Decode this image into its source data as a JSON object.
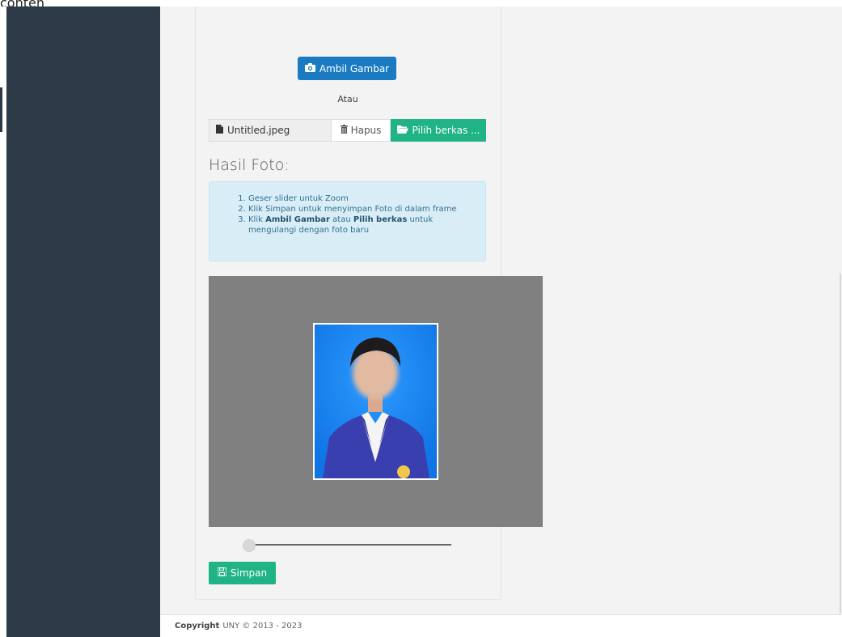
{
  "top_partial_text": "conten",
  "buttons": {
    "ambil": {
      "label": "Ambil Gambar",
      "icon": "camera-icon"
    },
    "hapus": {
      "label": "Hapus",
      "icon": "trash-icon"
    },
    "pilih": {
      "label": "Pilih berkas ...",
      "icon": "folder-open-icon"
    },
    "simpan": {
      "label": "Simpan",
      "icon": "save-icon"
    }
  },
  "atau_label": "Atau",
  "file": {
    "name": "Untitled.jpeg",
    "icon": "file-icon"
  },
  "hasil_title": "Hasil Foto:",
  "instructions": {
    "item1": "Geser slider untuk Zoom",
    "item2": "Klik Simpan untuk menyimpan Foto di dalam frame",
    "item3_prefix": "Klik ",
    "item3_bold1": "Ambil Gambar",
    "item3_mid": " atau ",
    "item3_bold2": "Pilih berkas",
    "item3_suffix": " untuk mengulangi dengan foto baru"
  },
  "zoom_slider": {
    "value": 0
  },
  "footer": {
    "bold": "Copyright",
    "text": "UNY © 2013 - 2023"
  },
  "colors": {
    "sidebar": "#2d3b48",
    "primary": "#1a7bc2",
    "success": "#1fb386",
    "info_bg": "#d9edf7",
    "crop_bg": "#808080",
    "photo_bg": "#1b86f0"
  }
}
